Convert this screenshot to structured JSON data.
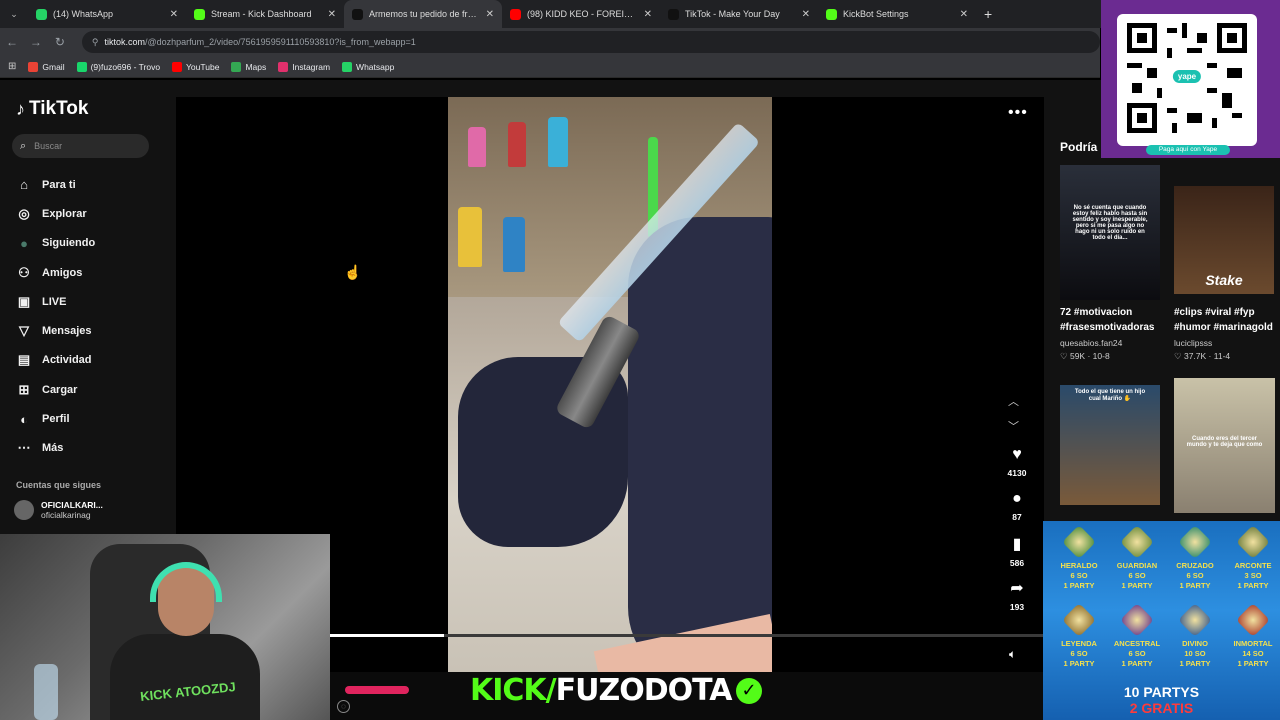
{
  "browser": {
    "tabs": [
      {
        "title": "(14) WhatsApp",
        "color": "#25d366",
        "active": false
      },
      {
        "title": "Stream - Kick Dashboard",
        "color": "#53fc18",
        "active": false
      },
      {
        "title": "Armemos tu pedido de frag...",
        "color": "#111111",
        "active": true
      },
      {
        "title": "(98) KIDD KEO - FOREIGN LETR...",
        "color": "#ff0000",
        "active": false
      },
      {
        "title": "TikTok - Make Your Day",
        "color": "#111111",
        "active": false
      },
      {
        "title": "KickBot Settings",
        "color": "#53fc18",
        "active": false
      }
    ],
    "url_host": "tiktok.com",
    "url_path": "/@dozhparfum_2/video/7561959591110593810?is_from_webapp=1",
    "bookmarks": [
      {
        "label": "Gmail",
        "color": "#ea4335"
      },
      {
        "label": "(9)fuzo696 - Trovo",
        "color": "#19d66b"
      },
      {
        "label": "YouTube",
        "color": "#ff0000"
      },
      {
        "label": "Maps",
        "color": "#34a853"
      },
      {
        "label": "Instagram",
        "color": "#e1306c"
      },
      {
        "label": "Whatsapp",
        "color": "#25d366"
      }
    ]
  },
  "tiktok": {
    "logo": "TikTok",
    "search_placeholder": "Buscar",
    "nav": [
      {
        "label": "Para ti",
        "icon": "home-icon",
        "glyph": "⌂"
      },
      {
        "label": "Explorar",
        "icon": "compass-icon",
        "glyph": "◎"
      },
      {
        "label": "Siguiendo",
        "icon": "following-avatar-icon",
        "glyph": "●"
      },
      {
        "label": "Amigos",
        "icon": "friends-icon",
        "glyph": "⚇"
      },
      {
        "label": "LIVE",
        "icon": "live-icon",
        "glyph": "▣"
      },
      {
        "label": "Mensajes",
        "icon": "messages-icon",
        "glyph": "▽"
      },
      {
        "label": "Actividad",
        "icon": "activity-icon",
        "glyph": "▤"
      },
      {
        "label": "Cargar",
        "icon": "upload-icon",
        "glyph": "⊞"
      },
      {
        "label": "Perfil",
        "icon": "profile-icon",
        "glyph": "◐"
      },
      {
        "label": "Más",
        "icon": "more-icon",
        "glyph": "⋯"
      }
    ],
    "following_title": "Cuentas que sigues",
    "following": {
      "name": "OFICIALKARI...",
      "handle": "oficialkarinag"
    },
    "actions": {
      "likes": "4130",
      "comments": "87",
      "saves": "586",
      "shares": "193"
    },
    "progress": 0.16,
    "suggestions_title": "Podría",
    "suggestions": [
      {
        "title": "72 #motivacion #frasesmotivadoras",
        "author": "quesabios.fan24",
        "meta": "♡ 59K · 10-8",
        "caption": "No sé cuenta que cuando estoy feliz hablo hasta sin sentido y soy inesperable, pero si me pasa algo no hago ni un solo ruido en todo el día..."
      },
      {
        "title": "#clips #viral #fyp #humor #marinagold",
        "author": "luciclipsss",
        "meta": "♡ 37.7K · 11-4",
        "caption": "Stake"
      },
      {
        "title": "",
        "author": "",
        "meta": "",
        "caption": "Todo el que tiene un hijo cual Mariño ✋"
      },
      {
        "title": "",
        "author": "",
        "meta": "",
        "caption": "Cuando eres del tercer mundo y te deja que como"
      }
    ]
  },
  "qr": {
    "badge": "yape",
    "pay_label": "Paga aquí con Yape"
  },
  "webcam": {
    "shirt_text": "KICK ATOOZDJ"
  },
  "stream": {
    "kick_prefix": "KICK/",
    "channel": "FUZODOTA"
  },
  "promo": {
    "ranks": [
      {
        "name": "HERALDO",
        "price": "6 SO",
        "party": "1 PARTY"
      },
      {
        "name": "GUARDIAN",
        "price": "6 SO",
        "party": "1 PARTY"
      },
      {
        "name": "CRUZADO",
        "price": "6 SO",
        "party": "1 PARTY"
      },
      {
        "name": "ARCONTE",
        "price": "3 SO",
        "party": "1 PARTY"
      },
      {
        "name": "LEYENDA",
        "price": "6 SO",
        "party": "1 PARTY"
      },
      {
        "name": "ANCESTRAL",
        "price": "6 SO",
        "party": "1 PARTY"
      },
      {
        "name": "DIVINO",
        "price": "10 SO",
        "party": "1 PARTY"
      },
      {
        "name": "INMORTAL",
        "price": "14 SO",
        "party": "1 PARTY"
      }
    ],
    "line1": "10 PARTYS",
    "line2": "2 GRATIS"
  }
}
